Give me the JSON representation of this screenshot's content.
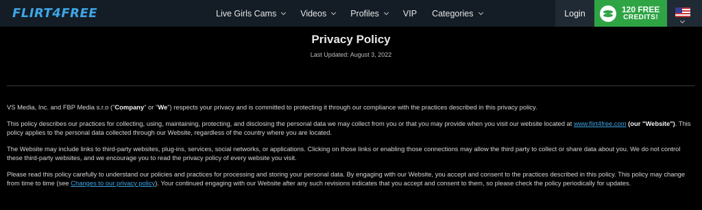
{
  "header": {
    "logo": "FLIRT4FREE",
    "nav": [
      {
        "label": "Live Girls Cams",
        "dropdown": true
      },
      {
        "label": "Videos",
        "dropdown": true
      },
      {
        "label": "Profiles",
        "dropdown": true
      },
      {
        "label": "VIP",
        "dropdown": false
      },
      {
        "label": "Categories",
        "dropdown": true
      }
    ],
    "login_label": "Login",
    "credits": {
      "line1": "120 FREE",
      "line2": "CREDITS!"
    },
    "language_flag": "us-flag-icon"
  },
  "page": {
    "title": "Privacy Policy",
    "last_updated": "Last Updated: August 3, 2022"
  },
  "body": {
    "p1": {
      "t1": "VS Media, Inc. and FBP Media s.r.o (\"",
      "b1": "Company",
      "t2": "\" or \"",
      "b2": "We",
      "t3": "\") respects your privacy and is committed to protecting it through our compliance with the practices described in this privacy policy."
    },
    "p2": {
      "t1": "This policy describes our practices for collecting, using, maintaining, protecting, and disclosing the personal data we may collect from you or that you may provide when you visit our website located at ",
      "link": "www.flirt4free.com",
      "b1": " (our \"Website\")",
      "t2": ". This policy applies to the personal data collected through our Website, regardless of the country where you are located."
    },
    "p3": "The Website may include links to third-party websites, plug-ins, services, social networks, or applications. Clicking on those links or enabling those connections may allow the third party to collect or share data about you. We do not control these third-party websites, and we encourage you to read the privacy policy of every website you visit.",
    "p4": {
      "t1": "Please read this policy carefully to understand our policies and practices for processing and storing your personal data. By engaging with our Website, you accept and consent to the practices described in this policy. This policy may change from time to time (see ",
      "link": "Changes to our privacy policy",
      "t2": "). Your continued engaging with our Website after any such revisions indicates that you accept and consent to them, so please check the policy periodically for updates."
    }
  },
  "colors": {
    "accent": "#3ea6e8",
    "credits_green": "#2fa445",
    "header_bg": "#141d26",
    "page_bg": "#000000"
  }
}
